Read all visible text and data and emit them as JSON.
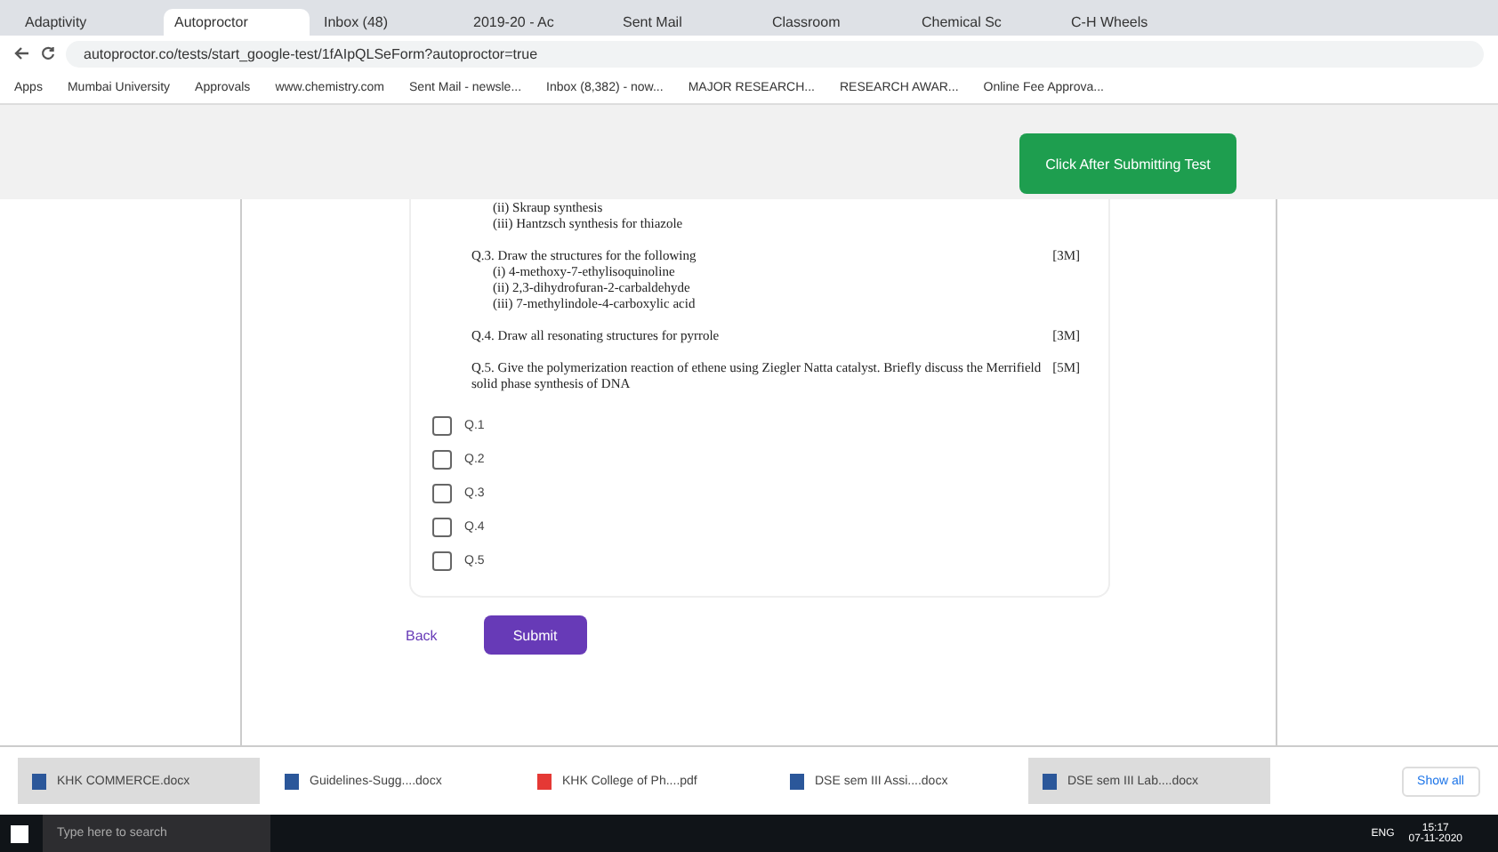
{
  "browser": {
    "tabs": [
      {
        "label": "Adaptivity",
        "selected": false
      },
      {
        "label": "Autoproctor",
        "selected": true
      },
      {
        "label": "Inbox (48)",
        "selected": false
      },
      {
        "label": "2019-20 - Ac",
        "selected": false
      },
      {
        "label": "Sent Mail",
        "selected": false
      },
      {
        "label": "Classroom",
        "selected": false
      },
      {
        "label": "Chemical Sc",
        "selected": false
      },
      {
        "label": "C-H Wheels",
        "selected": false
      }
    ],
    "address": "autoproctor.co/tests/start_google-test/1fAIpQLSeForm?autoproctor=true",
    "bookmarks": [
      "Apps",
      "Mumbai University",
      "Approvals",
      "www.chemistry.com",
      "Sent Mail - newsle...",
      "Inbox (8,382) - now...",
      "MAJOR RESEARCH...",
      "RESEARCH AWAR...",
      "Online Fee Approva..."
    ]
  },
  "header_button": "Click After Submitting Test",
  "questions": [
    {
      "lines": [
        "(ii) Skraup synthesis",
        "(iii) Hantzsch synthesis for thiazole"
      ]
    },
    {
      "lines": [
        "Q.3. Draw the structures for the following",
        "(i) 4-methoxy-7-ethylisoquinoline",
        "(ii) 2,3-dihydrofuran-2-carbaldehyde",
        "(iii) 7-methylindole-4-carboxylic acid"
      ],
      "marks": "[3M]"
    },
    {
      "lines": [
        "Q.4. Draw all resonating structures for pyrrole"
      ],
      "marks": "[3M]"
    },
    {
      "lines": [
        "Q.5. Give the polymerization reaction of ethene using Ziegler Natta catalyst. Briefly discuss the Merrifield solid phase synthesis of DNA"
      ],
      "marks": "[5M]"
    }
  ],
  "checkboxes": [
    {
      "label": "Q.1",
      "checked": false
    },
    {
      "label": "Q.2",
      "checked": false
    },
    {
      "label": "Q.3",
      "checked": false
    },
    {
      "label": "Q.4",
      "checked": false
    },
    {
      "label": "Q.5",
      "checked": false
    }
  ],
  "back": "Back",
  "submit": "Submit",
  "downloads": [
    {
      "name": "KHK COMMERCE.docx",
      "kind": "doc"
    },
    {
      "name": "Guidelines-Sugg....docx",
      "kind": "doc"
    },
    {
      "name": "KHK College of Ph....pdf",
      "kind": "pdf"
    },
    {
      "name": "DSE sem III Assi....docx",
      "kind": "doc"
    },
    {
      "name": "DSE sem III Lab....docx",
      "kind": "doc"
    }
  ],
  "show_all": "Show all",
  "taskbar": {
    "search": "Type here to search",
    "time": "15:17",
    "date": "07-11-2020",
    "lang": "ENG"
  }
}
